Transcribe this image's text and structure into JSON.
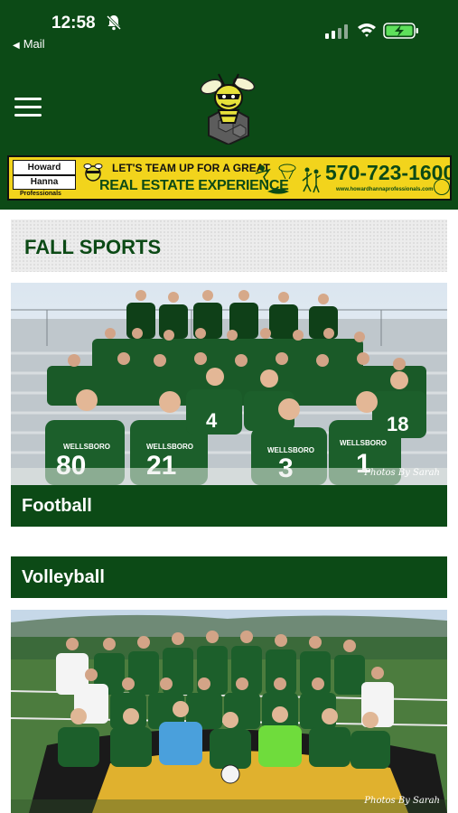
{
  "status_bar": {
    "time": "12:58",
    "back_app": "Mail",
    "icons": [
      "bell-slash-icon",
      "cellular-signal-icon",
      "wifi-icon",
      "battery-charging-icon"
    ]
  },
  "header": {
    "menu_icon": "hamburger-menu-icon",
    "logo": "hornet-mascot-logo"
  },
  "ad": {
    "brand_top": "Howard",
    "brand_bottom": "Hanna",
    "brand_sub": "Professionals",
    "headline": "LET'S TEAM UP FOR A GREAT",
    "tagline": "REAL ESTATE EXPERIENCE",
    "phone": "570-723-1600",
    "url": "www.howardhannaprofessionals.com"
  },
  "section": {
    "title": "FALL SPORTS"
  },
  "sports": [
    {
      "name": "Football",
      "photo_credit": "Photos By Sarah",
      "jersey_text": "WELLSBORO",
      "jersey_numbers": [
        "80",
        "21",
        "3",
        "1",
        "4",
        "18"
      ]
    },
    {
      "name": "Volleyball",
      "photo_credit": "Photos By Sarah"
    }
  ],
  "colors": {
    "brand_green": "#0c4a16",
    "ad_yellow": "#f2d41c",
    "section_bg": "#ececec"
  }
}
